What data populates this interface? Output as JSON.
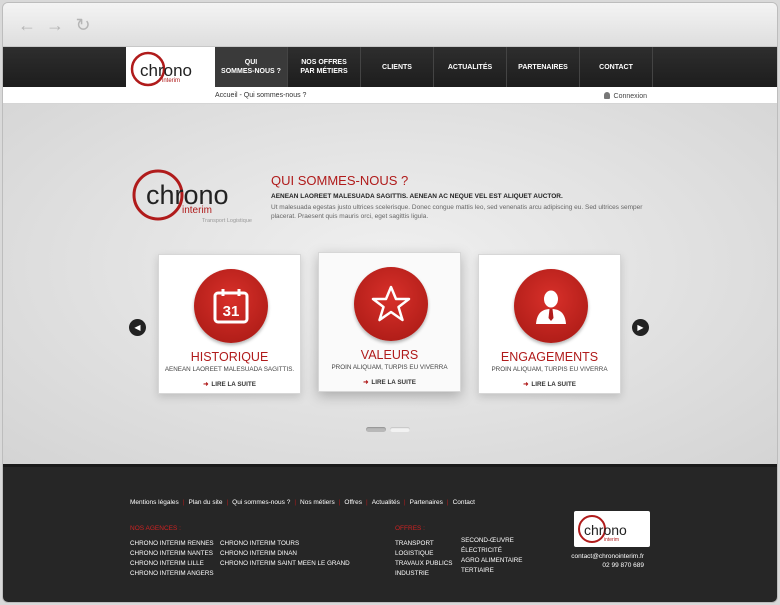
{
  "browser": {
    "back_icon": "back-arrow-icon",
    "forward_icon": "forward-arrow-icon",
    "reload_icon": "reload-icon"
  },
  "brand": {
    "logo_text": "chrono",
    "logo_sub": "interim",
    "logo_tagline": "Transport Logistique",
    "accent": "#b01b1b"
  },
  "menu": [
    {
      "label": "QUI\nSOMMES-NOUS ?",
      "active": true
    },
    {
      "label": "NOS OFFRES\nPAR MÉTIERS",
      "active": false
    },
    {
      "label": "CLIENTS",
      "active": false
    },
    {
      "label": "ACTUALITÉS",
      "active": false
    },
    {
      "label": "PARTENAIRES",
      "active": false
    },
    {
      "label": "CONTACT",
      "active": false
    }
  ],
  "breadcrumb": "Accueil - Qui sommes-nous ?",
  "login_label": "Connexion",
  "intro": {
    "title": "QUI SOMMES-NOUS ?",
    "lead": "AENEAN LAOREET MALESUADA SAGITTIS. AENEAN AC NEQUE VEL EST ALIQUET AUCTOR.",
    "text": "Ut malesuada egestas justo ultrices scelerisque. Donec congue mattis leo, sed venenatis arcu adipiscing eu. Sed ultrices semper placerat. Praesent quis mauris orci, eget sagittis ligula."
  },
  "cards": [
    {
      "title": "HISTORIQUE",
      "subtitle": "AENEAN LAOREET MALESUADA SAGITTIS.",
      "more": "LIRE LA SUITE",
      "icon": "calendar-icon",
      "calendar_day": "31"
    },
    {
      "title": "VALEURS",
      "subtitle": "PROIN ALIQUAM, TURPIS EU VIVERRA",
      "more": "LIRE LA SUITE",
      "icon": "star-icon"
    },
    {
      "title": "ENGAGEMENTS",
      "subtitle": "PROIN ALIQUAM, TURPIS EU VIVERRA",
      "more": "LIRE LA SUITE",
      "icon": "person-icon"
    }
  ],
  "slider": {
    "prev_icon": "prev-arrow-icon",
    "next_icon": "next-arrow-icon",
    "dots": 2,
    "active_dot": 1
  },
  "footer": {
    "links": [
      "Mentions légales",
      "Plan du site",
      "Qui sommes-nous ?",
      "Nos métiers",
      "Offres",
      "Actualités",
      "Partenaires",
      "Contact"
    ],
    "agencies_title": "NOS AGENCES :",
    "agencies_col1": [
      "CHRONO INTERIM RENNES",
      "CHRONO INTERIM NANTES",
      "CHRONO INTERIM LILLE",
      "CHRONO INTERIM ANGERS"
    ],
    "agencies_col2": [
      "CHRONO INTERIM TOURS",
      "CHRONO INTERIM DINAN",
      "CHRONO INTERIM SAINT MEEN LE GRAND"
    ],
    "offers_title": "OFFRES :",
    "offers_col1": [
      "TRANSPORT",
      "LOGISTIQUE",
      "TRAVAUX PUBLICS",
      "INDUSTRIE"
    ],
    "offers_col2": [
      "SECOND-ŒUVRE",
      "ÉLECTRICITÉ",
      "AGRO ALIMENTAIRE",
      "TERTIAIRE"
    ],
    "email": "contact@chronointerim.fr",
    "phone": "02 99 870 689"
  }
}
